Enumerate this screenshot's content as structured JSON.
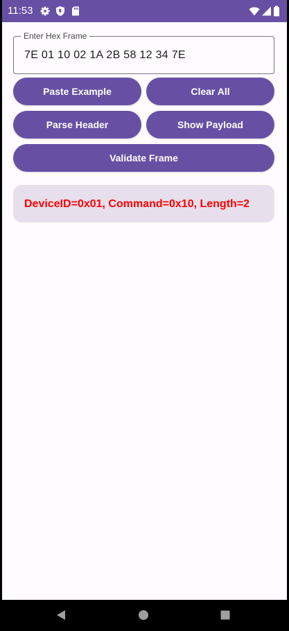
{
  "status_bar": {
    "time": "11:53",
    "icons": [
      "gear-icon",
      "shield-icon",
      "sd-card-icon",
      "wifi-icon",
      "signal-icon",
      "battery-icon"
    ]
  },
  "form": {
    "label": "Enter Hex Frame",
    "value": "7E 01 10 02 1A 2B 58 12 34 7E"
  },
  "buttons": {
    "paste_example": "Paste Example",
    "clear_all": "Clear All",
    "parse_header": "Parse Header",
    "show_payload": "Show Payload",
    "validate_frame": "Validate Frame"
  },
  "result": {
    "text": "DeviceID=0x01, Command=0x10, Length=2"
  },
  "nav_bar": {
    "icons": [
      "back-icon",
      "home-icon",
      "recents-icon"
    ]
  },
  "colors": {
    "primary": "#6750a4",
    "background": "#fffbfe",
    "result_background": "#e7e0ec",
    "result_text": "#ff0000"
  }
}
